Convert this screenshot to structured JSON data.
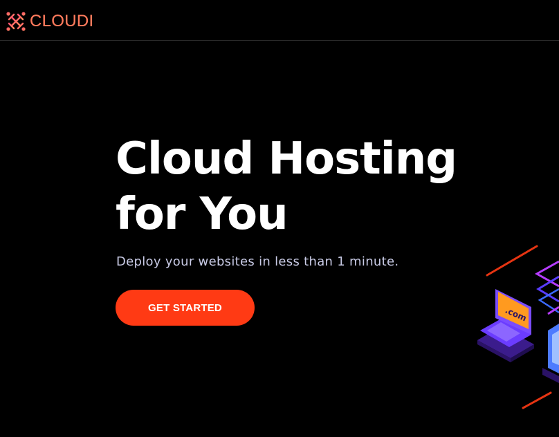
{
  "nav": {
    "brand_name": "CLOUDI",
    "brand_icon": "logo-icon"
  },
  "hero": {
    "title_line1": "Cloud Hosting",
    "title_line2": "for You",
    "subtitle": "Deploy your websites in less than 1 minute.",
    "cta_label": "GET STARTED"
  },
  "illustration": {
    "laptop_screen_text": ".com"
  },
  "colors": {
    "background": "#000000",
    "accent": "#ff3a14",
    "brand_text": "#ff7a5c",
    "subtitle_text": "#c9cbe6"
  }
}
